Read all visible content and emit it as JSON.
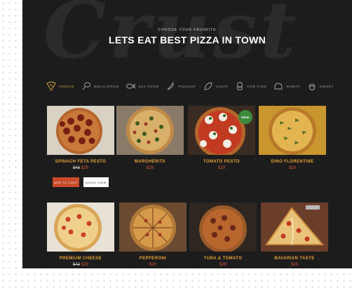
{
  "hero": {
    "script_text": "Crust",
    "eyebrow": "CHOOSE YOUR FAVORITE",
    "title": "LETS EAT BEST PIZZA IN TOWN"
  },
  "categories": [
    {
      "label": "VEGGIE",
      "icon": "pizza-icon",
      "active": true
    },
    {
      "label": "DELICATESS",
      "icon": "drumstick-icon",
      "active": false
    },
    {
      "label": "SEA FOOD",
      "icon": "fish-icon",
      "active": false
    },
    {
      "label": "PIQUANT",
      "icon": "pepper-icon",
      "active": false
    },
    {
      "label": "LIGHT",
      "icon": "leaf-icon",
      "active": false
    },
    {
      "label": "FOR KIDS",
      "icon": "chef-icon",
      "active": false
    },
    {
      "label": "WHEAT",
      "icon": "bread-icon",
      "active": false
    },
    {
      "label": "SWEET",
      "icon": "cupcake-icon",
      "active": false
    }
  ],
  "products": [
    {
      "name": "SPINACH FETA PESTO",
      "old_price": "$43",
      "price": "$29",
      "style": "pepperoni"
    },
    {
      "name": "MARGHERITA",
      "old_price": "",
      "price": "$29",
      "style": "herb"
    },
    {
      "name": "TOMATO PESTO",
      "old_price": "",
      "price": "$29",
      "style": "mozzarella",
      "badge": "NEW"
    },
    {
      "name": "DINO FLORENTINE",
      "old_price": "",
      "price": "$29",
      "style": "arugula"
    },
    {
      "name": "PREMIUM CHEESE",
      "old_price": "$43",
      "price": "$29",
      "style": "cheese"
    },
    {
      "name": "PEPPERONI",
      "old_price": "",
      "price": "$29",
      "style": "sliced"
    },
    {
      "name": "TUNA & TOMATO",
      "old_price": "",
      "price": "$29",
      "style": "meat"
    },
    {
      "name": "BAVARIAN TASTE",
      "old_price": "",
      "price": "$29",
      "style": "slice"
    }
  ],
  "buttons": {
    "add_to_cart": "ADD TO CART",
    "quick_view": "QUICK VIEW"
  },
  "colors": {
    "panel": "#1c1c1c",
    "accent_orange": "#e8a33a",
    "price_red": "#d6553a",
    "cart_button": "#c94a2a",
    "badge_green": "#3d8a3c"
  }
}
